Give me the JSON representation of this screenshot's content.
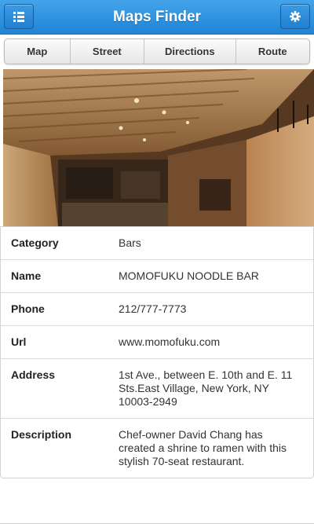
{
  "header": {
    "title": "Maps Finder",
    "menu_icon": "list-icon",
    "settings_icon": "gear-icon"
  },
  "tabs": [
    {
      "label": "Map"
    },
    {
      "label": "Street"
    },
    {
      "label": "Directions"
    },
    {
      "label": "Route"
    }
  ],
  "photo": {
    "icon": "restaurant-interior-photo"
  },
  "details": [
    {
      "label": "Category",
      "value": "Bars"
    },
    {
      "label": "Name",
      "value": "MOMOFUKU NOODLE BAR"
    },
    {
      "label": "Phone",
      "value": "212/777-7773"
    },
    {
      "label": "Url",
      "value": "www.momofuku.com"
    },
    {
      "label": "Address",
      "value": "1st Ave., between E. 10th and E. 11 Sts.East Village, New York, NY 10003-2949"
    },
    {
      "label": "Description",
      "value": "Chef-owner David Chang has created a shrine to ramen with this stylish 70-seat restaurant."
    }
  ],
  "colors": {
    "header_top": "#43a4ea",
    "header_bottom": "#1f84d6"
  }
}
